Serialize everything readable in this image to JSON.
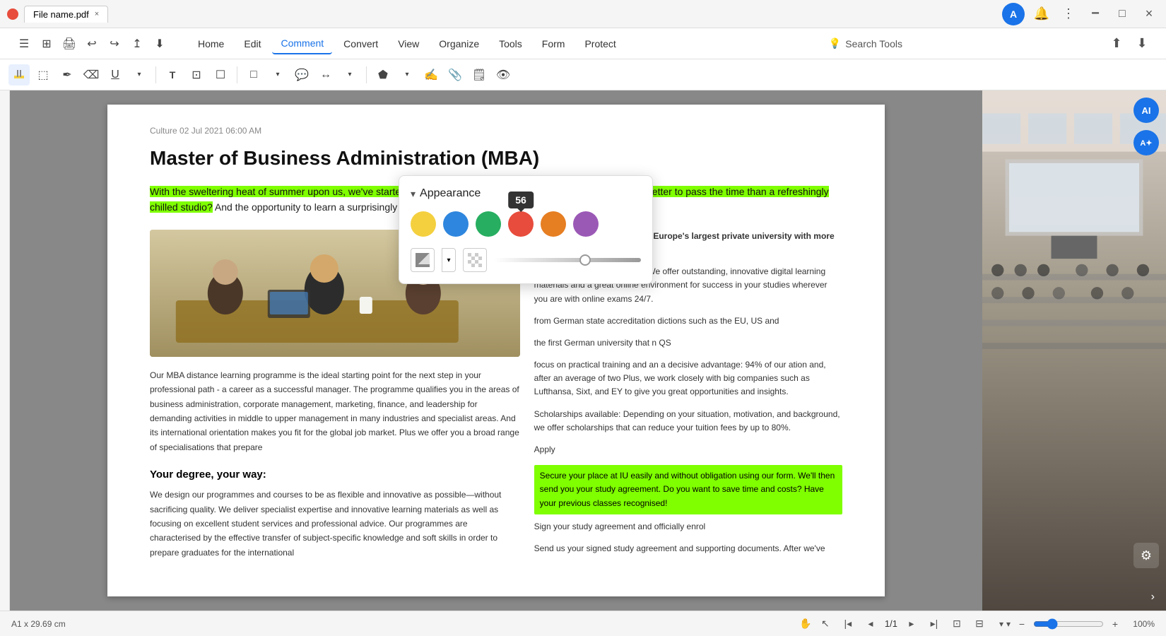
{
  "titlebar": {
    "filename": "File name.pdf",
    "close_label": "×",
    "minimize_label": "−",
    "maximize_label": "□",
    "close_window": "×"
  },
  "menubar": {
    "items": [
      {
        "id": "home",
        "label": "Home"
      },
      {
        "id": "edit",
        "label": "Edit"
      },
      {
        "id": "comment",
        "label": "Comment",
        "active": true
      },
      {
        "id": "convert",
        "label": "Convert"
      },
      {
        "id": "view",
        "label": "View"
      },
      {
        "id": "organize",
        "label": "Organize"
      },
      {
        "id": "tools",
        "label": "Tools"
      },
      {
        "id": "form",
        "label": "Form"
      },
      {
        "id": "protect",
        "label": "Protect"
      }
    ],
    "search_placeholder": "Search Tools"
  },
  "document": {
    "meta": "Culture 02 Jul 2021 06:00 AM",
    "title": "Master of Business Administration (MBA)",
    "intro_highlighted": "With the sweltering heat of summer upon us, we've started to embrace indoor activities with a vengeance. Where better to pass the time than a refreshingly chilled studio?",
    "intro_normal": " And the opportunity to learn a surprisingly wholesome new skill while we're at it.",
    "right_col": {
      "item1": "#1 University in Europe: Join Europe's largest private university with more than 85,000 students",
      "item2": "Digital, Flexible, 100% online: We offer outstanding, innovative digital learning materials and a great online environment for success in your studies wherever you are with online exams 24/7.",
      "item3": "from German state accreditation dictions such as the EU, US and",
      "item4": "the first German university that n QS",
      "item5": "focus on practical training and an a decisive advantage: 94% of our ation and, after an average of two Plus, we work closely with big companies such as Lufthansa, Sixt, and EY to give you great opportunities and insights.",
      "scholarships": "Scholarships available: Depending on your situation, motivation, and background, we offer scholarships that can reduce your tuition fees by up to 80%.",
      "apply_label": "Apply",
      "apply_highlight": "Secure your place at IU easily and without obligation using our form. We'll then send you your study agreement. Do you want to save time and costs? Have your previous classes recognised!",
      "sign": "Sign your study agreement and officially enrol",
      "send": "Send us your signed study agreement and supporting documents. After we've"
    },
    "body_left_title": "Your degree, your way:",
    "body_left": "We design our programmes and courses to be as flexible and innovative as possible—without sacrificing quality. We deliver specialist expertise and innovative learning materials as well as focusing on excellent student services and professional advice. Our programmes are characterised by the effective transfer of subject-specific knowledge and soft skills in order to prepare graduates for the international",
    "body_right": "Our MBA distance learning programme is the ideal starting point for the next step in your professional path - a career as a successful manager. The programme qualifies you in the areas of business administration, corporate management, marketing, finance, and leadership for demanding activities in middle to upper management in many industries and specialist areas. And its international orientation makes you fit for the global job market. Plus we offer you a broad range of specialisations that prepare"
  },
  "appearance": {
    "title": "Appearance",
    "colors": [
      {
        "id": "yellow",
        "label": "Yellow"
      },
      {
        "id": "blue",
        "label": "Blue"
      },
      {
        "id": "green",
        "label": "Green"
      },
      {
        "id": "red",
        "label": "Red"
      },
      {
        "id": "orange",
        "label": "Orange"
      },
      {
        "id": "purple",
        "label": "Purple"
      }
    ],
    "opacity_value": "56",
    "opacity_percent": 62
  },
  "statusbar": {
    "dimensions": "A1 x 29.69 cm",
    "page_current": "1",
    "page_total": "1",
    "zoom_level": "100%"
  },
  "toolbar": {
    "tools": [
      {
        "id": "highlight",
        "icon": "✏",
        "label": "Highlight"
      },
      {
        "id": "select-area",
        "icon": "⬚",
        "label": "Select Area"
      },
      {
        "id": "pencil",
        "icon": "✒",
        "label": "Pencil"
      },
      {
        "id": "eraser",
        "icon": "⌫",
        "label": "Eraser"
      },
      {
        "id": "underline",
        "icon": "U̲",
        "label": "Underline"
      },
      {
        "id": "text",
        "icon": "T",
        "label": "Text"
      },
      {
        "id": "crop",
        "icon": "⊡",
        "label": "Crop"
      },
      {
        "id": "textbox",
        "icon": "☐",
        "label": "Text Box"
      },
      {
        "id": "rectangle",
        "icon": "□",
        "label": "Rectangle"
      },
      {
        "id": "callout",
        "icon": "💬",
        "label": "Callout"
      },
      {
        "id": "measure",
        "icon": "↔",
        "label": "Measure"
      },
      {
        "id": "stamp",
        "icon": "⬟",
        "label": "Stamp"
      },
      {
        "id": "signature",
        "icon": "✍",
        "label": "Signature"
      },
      {
        "id": "attach",
        "icon": "📎",
        "label": "Attach"
      },
      {
        "id": "sticker",
        "icon": "🗒",
        "label": "Sticker"
      },
      {
        "id": "eye",
        "icon": "👁",
        "label": "Eye"
      }
    ]
  }
}
